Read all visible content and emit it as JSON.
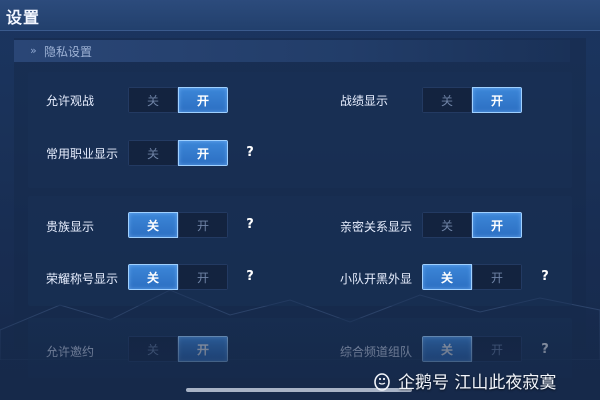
{
  "header": {
    "title": "设置"
  },
  "section": {
    "label": "隐私设置"
  },
  "toggle_labels": {
    "off": "关",
    "on": "开"
  },
  "help_glyph": "?",
  "settings": [
    {
      "key": "allow_spectate",
      "label": "允许观战",
      "state": "on"
    },
    {
      "key": "record_display",
      "label": "战绩显示",
      "state": "on"
    },
    {
      "key": "common_role_display",
      "label": "常用职业显示",
      "state": "on"
    },
    {
      "key": "noble_display",
      "label": "贵族显示",
      "state": "off"
    },
    {
      "key": "intimacy_display",
      "label": "亲密关系显示",
      "state": "on"
    },
    {
      "key": "honor_title_display",
      "label": "荣耀称号显示",
      "state": "off"
    },
    {
      "key": "team_black_look",
      "label": "小队开黑外显",
      "state": "off"
    },
    {
      "key": "allow_invite",
      "label": "允许邀约",
      "state": "on"
    },
    {
      "key": "channel_team",
      "label": "综合频道组队",
      "state": "off"
    }
  ],
  "watermark": {
    "text": "企鹅号 江山此夜寂寞"
  },
  "colors": {
    "accent": "#3c86d8",
    "background": "#1a3259",
    "toggle_off_bg": "#13233f"
  }
}
